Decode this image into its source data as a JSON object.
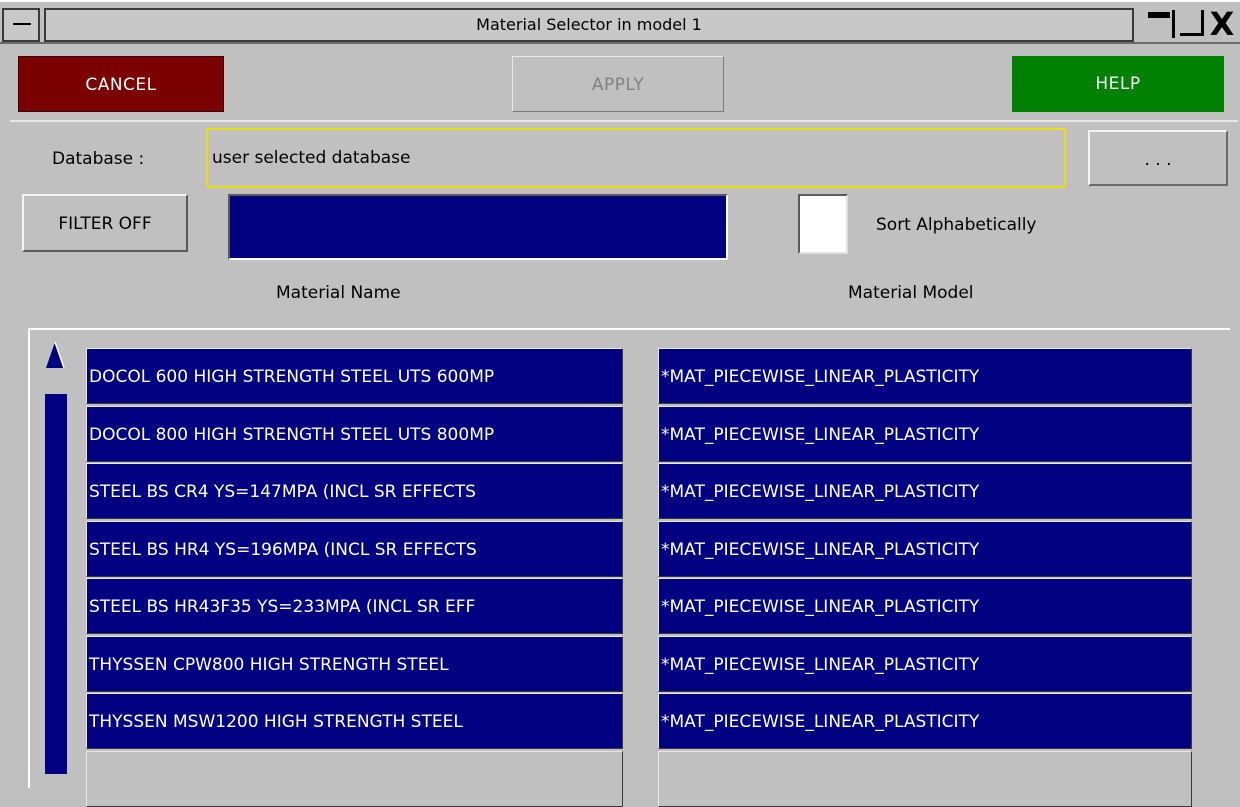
{
  "window": {
    "title": "Material Selector in model 1",
    "close_glyph": "X",
    "icons": [
      "system-menu-icon",
      "minimize-icon",
      "maximize-icon",
      "close-icon"
    ]
  },
  "buttons": {
    "cancel": "CANCEL",
    "apply": "APPLY",
    "help": "HELP"
  },
  "database": {
    "label": "Database :",
    "value": "user selected database",
    "browse_label": ". . ."
  },
  "filter": {
    "button_label": "FILTER OFF",
    "value": ""
  },
  "sort": {
    "label": "Sort Alphabetically",
    "checked": false
  },
  "columns": {
    "name": "Material Name",
    "model": "Material Model"
  },
  "materials": [
    {
      "name": "DOCOL 600 HIGH STRENGTH STEEL UTS 600MP",
      "model": "*MAT_PIECEWISE_LINEAR_PLASTICITY"
    },
    {
      "name": "DOCOL 800 HIGH STRENGTH STEEL UTS 800MP",
      "model": "*MAT_PIECEWISE_LINEAR_PLASTICITY"
    },
    {
      "name": "STEEL BS CR4 YS=147MPA (INCL SR EFFECTS",
      "model": "*MAT_PIECEWISE_LINEAR_PLASTICITY"
    },
    {
      "name": "STEEL BS HR4 YS=196MPA (INCL SR EFFECTS",
      "model": "*MAT_PIECEWISE_LINEAR_PLASTICITY"
    },
    {
      "name": "STEEL BS HR43F35 YS=233MPA (INCL SR EFF",
      "model": "*MAT_PIECEWISE_LINEAR_PLASTICITY"
    },
    {
      "name": "THYSSEN CPW800 HIGH STRENGTH STEEL",
      "model": "*MAT_PIECEWISE_LINEAR_PLASTICITY"
    },
    {
      "name": "THYSSEN MSW1200 HIGH STRENGTH STEEL",
      "model": "*MAT_PIECEWISE_LINEAR_PLASTICITY"
    },
    {
      "name": "",
      "model": ""
    }
  ],
  "colors": {
    "background": "#c0c0c0",
    "cancel": "#7b0000",
    "help": "#008000",
    "selection": "#000080",
    "database_border": "#e8e000"
  }
}
